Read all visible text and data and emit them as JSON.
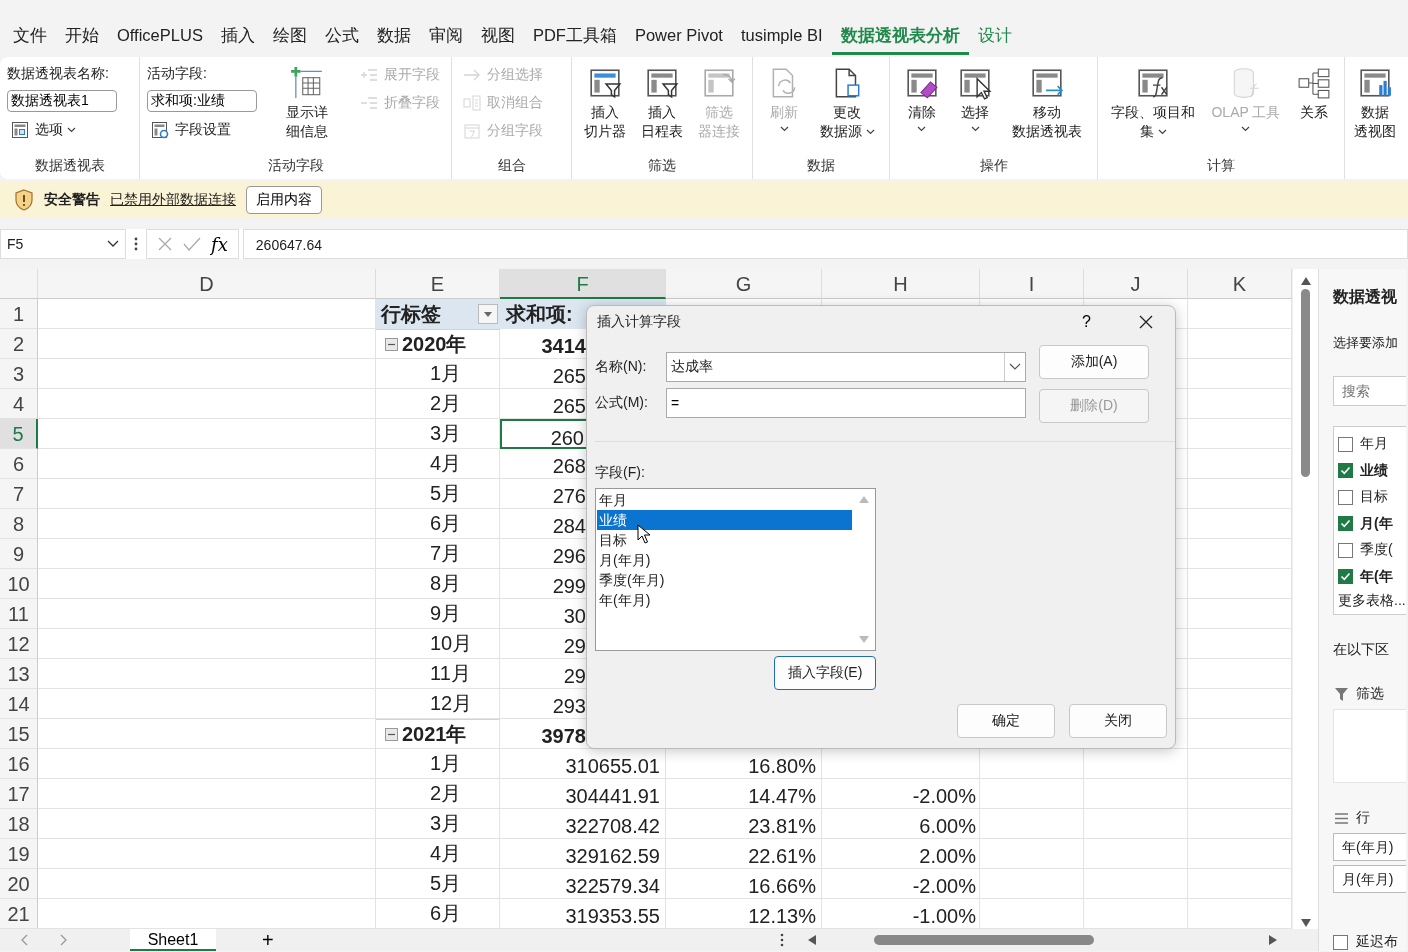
{
  "tabs": [
    {
      "label": "文件",
      "selected": false,
      "kind": "normal"
    },
    {
      "label": "开始",
      "selected": false,
      "kind": "normal"
    },
    {
      "label": "OfficePLUS",
      "selected": false,
      "kind": "normal"
    },
    {
      "label": "插入",
      "selected": false,
      "kind": "normal"
    },
    {
      "label": "绘图",
      "selected": false,
      "kind": "normal"
    },
    {
      "label": "公式",
      "selected": false,
      "kind": "normal"
    },
    {
      "label": "数据",
      "selected": false,
      "kind": "normal"
    },
    {
      "label": "审阅",
      "selected": false,
      "kind": "normal"
    },
    {
      "label": "视图",
      "selected": false,
      "kind": "normal"
    },
    {
      "label": "PDF工具箱",
      "selected": false,
      "kind": "normal"
    },
    {
      "label": "Power Pivot",
      "selected": false,
      "kind": "normal"
    },
    {
      "label": "tusimple BI",
      "selected": false,
      "kind": "normal"
    },
    {
      "label": "数据透视表分析",
      "selected": true,
      "kind": "contextual"
    },
    {
      "label": "设计",
      "selected": false,
      "kind": "contextual"
    }
  ],
  "ribbon": {
    "groups": [
      {
        "label": "数据透视表",
        "columns": [
          [
            {
              "kind": "caption",
              "text": "数据透视表名称:"
            },
            {
              "kind": "input",
              "value": "数据透视表1"
            },
            {
              "kind": "small",
              "lines": [
                "选项"
              ],
              "disabled": false,
              "dropdown": true
            }
          ]
        ]
      },
      {
        "label": "活动字段",
        "columns": [
          [
            {
              "kind": "caption",
              "text": "活动字段:"
            },
            {
              "kind": "input",
              "value": "求和项:业绩"
            },
            {
              "kind": "small",
              "lines": [
                "字段设置"
              ],
              "disabled": false,
              "dropdown": false
            }
          ],
          [
            {
              "kind": "large",
              "lines": [
                "显示详",
                "细信息"
              ],
              "disabled": false,
              "dropdown": false
            }
          ],
          [
            {
              "kind": "small",
              "lines": [
                "展开字段"
              ],
              "disabled": true,
              "dropdown": false
            },
            {
              "kind": "small",
              "lines": [
                "折叠字段"
              ],
              "disabled": true,
              "dropdown": false
            }
          ]
        ]
      },
      {
        "label": "组合",
        "columns": [
          [
            {
              "kind": "small",
              "lines": [
                "分组选择"
              ],
              "disabled": true,
              "dropdown": false
            },
            {
              "kind": "small",
              "lines": [
                "取消组合"
              ],
              "disabled": true,
              "dropdown": false
            },
            {
              "kind": "small",
              "lines": [
                "分组字段"
              ],
              "disabled": true,
              "dropdown": false
            }
          ]
        ]
      },
      {
        "label": "筛选",
        "columns": [
          [
            {
              "kind": "large",
              "lines": [
                "插入",
                "切片器"
              ],
              "disabled": false,
              "dropdown": false
            }
          ],
          [
            {
              "kind": "large",
              "lines": [
                "插入",
                "日程表"
              ],
              "disabled": false,
              "dropdown": false
            }
          ],
          [
            {
              "kind": "large",
              "lines": [
                "筛选",
                "器连接"
              ],
              "disabled": true,
              "dropdown": false
            }
          ]
        ]
      },
      {
        "label": "数据",
        "columns": [
          [
            {
              "kind": "large",
              "lines": [
                "刷新"
              ],
              "disabled": true,
              "dropdown": true
            }
          ],
          [
            {
              "kind": "large",
              "lines": [
                "更改",
                "数据源"
              ],
              "disabled": false,
              "dropdown": true
            }
          ]
        ]
      },
      {
        "label": "操作",
        "columns": [
          [
            {
              "kind": "large",
              "lines": [
                "清除"
              ],
              "disabled": false,
              "dropdown": true
            }
          ],
          [
            {
              "kind": "large",
              "lines": [
                "选择"
              ],
              "disabled": false,
              "dropdown": true
            }
          ],
          [
            {
              "kind": "large",
              "lines": [
                "移动",
                "数据透视表"
              ],
              "disabled": false,
              "dropdown": false
            }
          ]
        ]
      },
      {
        "label": "计算",
        "columns": [
          [
            {
              "kind": "large",
              "lines": [
                "字段、项目和",
                "集"
              ],
              "disabled": false,
              "dropdown": true
            }
          ],
          [
            {
              "kind": "large",
              "lines": [
                "OLAP 工具"
              ],
              "disabled": true,
              "dropdown": true
            }
          ],
          [
            {
              "kind": "large",
              "lines": [
                "关系"
              ],
              "disabled": false,
              "dropdown": false
            }
          ]
        ]
      },
      {
        "columns": [
          [
            {
              "kind": "large",
              "lines": [
                "数据",
                "透视图"
              ],
              "disabled": false,
              "dropdown": false
            }
          ]
        ]
      }
    ]
  },
  "security_bar": {
    "title": "安全警告",
    "message": "已禁用外部数据连接",
    "button": "启用内容"
  },
  "formula_bar": {
    "name_box": "F5",
    "function_button": "fx",
    "formula": "260647.64"
  },
  "sheet": {
    "columns": [
      {
        "label": "D",
        "selected": false
      },
      {
        "label": "E",
        "selected": false
      },
      {
        "label": "F",
        "selected": true
      },
      {
        "label": "G",
        "selected": false
      },
      {
        "label": "H",
        "selected": false
      },
      {
        "label": "I",
        "selected": false
      },
      {
        "label": "J",
        "selected": false
      },
      {
        "label": "K",
        "selected": false
      }
    ],
    "rows": [
      {
        "number": "1",
        "selected": false,
        "cells": [
          "",
          {
            "kind": "heading",
            "text": "行标签",
            "filter": true,
            "active": false
          },
          {
            "kind": "heading",
            "text": "求和项:",
            "filter": false,
            "active": false
          }
        ]
      },
      {
        "number": "2",
        "selected": false,
        "cells": [
          "",
          {
            "kind": "group",
            "text": "2020年",
            "expanded": true,
            "active": false
          },
          {
            "kind": "total",
            "text": "3414",
            "active": false
          }
        ]
      },
      {
        "number": "3",
        "selected": false,
        "cells": [
          "",
          {
            "kind": "label",
            "text": "1月",
            "active": false
          },
          {
            "kind": "number",
            "text": "265",
            "active": false
          }
        ]
      },
      {
        "number": "4",
        "selected": false,
        "cells": [
          "",
          {
            "kind": "label",
            "text": "2月",
            "active": false
          },
          {
            "kind": "number",
            "text": "265",
            "active": false
          }
        ]
      },
      {
        "number": "5",
        "selected": true,
        "cells": [
          "",
          {
            "kind": "label",
            "text": "3月",
            "active": false
          },
          {
            "kind": "number",
            "text": "260",
            "active": true
          }
        ]
      },
      {
        "number": "6",
        "selected": false,
        "cells": [
          "",
          {
            "kind": "label",
            "text": "4月",
            "active": false
          },
          {
            "kind": "number",
            "text": "268",
            "active": false
          }
        ]
      },
      {
        "number": "7",
        "selected": false,
        "cells": [
          "",
          {
            "kind": "label",
            "text": "5月",
            "active": false
          },
          {
            "kind": "number",
            "text": "276",
            "active": false
          }
        ]
      },
      {
        "number": "8",
        "selected": false,
        "cells": [
          "",
          {
            "kind": "label",
            "text": "6月",
            "active": false
          },
          {
            "kind": "number",
            "text": "284",
            "active": false
          }
        ]
      },
      {
        "number": "9",
        "selected": false,
        "cells": [
          "",
          {
            "kind": "label",
            "text": "7月",
            "active": false
          },
          {
            "kind": "number",
            "text": "296",
            "active": false
          }
        ]
      },
      {
        "number": "10",
        "selected": false,
        "cells": [
          "",
          {
            "kind": "label",
            "text": "8月",
            "active": false
          },
          {
            "kind": "number",
            "text": "299",
            "active": false
          }
        ]
      },
      {
        "number": "11",
        "selected": false,
        "cells": [
          "",
          {
            "kind": "label",
            "text": "9月",
            "active": false
          },
          {
            "kind": "number",
            "text": "30",
            "active": false
          }
        ]
      },
      {
        "number": "12",
        "selected": false,
        "cells": [
          "",
          {
            "kind": "label",
            "text": "10月",
            "active": false
          },
          {
            "kind": "number",
            "text": "29",
            "active": false
          }
        ]
      },
      {
        "number": "13",
        "selected": false,
        "cells": [
          "",
          {
            "kind": "label",
            "text": "11月",
            "active": false
          },
          {
            "kind": "number",
            "text": "29",
            "active": false
          }
        ]
      },
      {
        "number": "14",
        "selected": false,
        "cells": [
          "",
          {
            "kind": "label",
            "text": "12月",
            "active": false
          },
          {
            "kind": "number",
            "text": "293",
            "active": false
          }
        ]
      },
      {
        "number": "15",
        "selected": false,
        "cells": [
          "",
          {
            "kind": "group",
            "text": "2021年",
            "expanded": true,
            "active": false
          },
          {
            "kind": "total",
            "text": "3978",
            "active": false
          }
        ]
      },
      {
        "number": "16",
        "selected": false,
        "cells": [
          "",
          {
            "kind": "label",
            "text": "1月",
            "active": false
          },
          {
            "kind": "number",
            "text": "310655.01",
            "active": false
          },
          {
            "kind": "number",
            "text": "16.80%",
            "active": false
          }
        ]
      },
      {
        "number": "17",
        "selected": false,
        "cells": [
          "",
          {
            "kind": "label",
            "text": "2月",
            "active": false
          },
          {
            "kind": "number",
            "text": "304441.91",
            "active": false
          },
          {
            "kind": "number",
            "text": "14.47%",
            "active": false
          },
          {
            "kind": "number",
            "text": "-2.00%",
            "active": false
          }
        ]
      },
      {
        "number": "18",
        "selected": false,
        "cells": [
          "",
          {
            "kind": "label",
            "text": "3月",
            "active": false
          },
          {
            "kind": "number",
            "text": "322708.42",
            "active": false
          },
          {
            "kind": "number",
            "text": "23.81%",
            "active": false
          },
          {
            "kind": "number",
            "text": "6.00%",
            "active": false
          }
        ]
      },
      {
        "number": "19",
        "selected": false,
        "cells": [
          "",
          {
            "kind": "label",
            "text": "4月",
            "active": false
          },
          {
            "kind": "number",
            "text": "329162.59",
            "active": false
          },
          {
            "kind": "number",
            "text": "22.61%",
            "active": false
          },
          {
            "kind": "number",
            "text": "2.00%",
            "active": false
          }
        ]
      },
      {
        "number": "20",
        "selected": false,
        "cells": [
          "",
          {
            "kind": "label",
            "text": "5月",
            "active": false
          },
          {
            "kind": "number",
            "text": "322579.34",
            "active": false
          },
          {
            "kind": "number",
            "text": "16.66%",
            "active": false
          },
          {
            "kind": "number",
            "text": "-2.00%",
            "active": false
          }
        ]
      },
      {
        "number": "21",
        "selected": false,
        "cells": [
          "",
          {
            "kind": "label",
            "text": "6月",
            "active": false
          },
          {
            "kind": "number",
            "text": "319353.55",
            "active": false
          },
          {
            "kind": "number",
            "text": "12.13%",
            "active": false
          },
          {
            "kind": "number",
            "text": "-1.00%",
            "active": false
          }
        ]
      }
    ]
  },
  "dialog": {
    "title": "插入计算字段",
    "help": "?",
    "name_label": "名称(N):",
    "name_value": "达成率",
    "formula_label": "公式(M):",
    "formula_value": "=",
    "side_buttons": [
      {
        "label": "添加(A)",
        "disabled": false
      },
      {
        "label": "删除(D)",
        "disabled": true
      }
    ],
    "fields_label": "字段(F):",
    "fields": [
      {
        "label": "年月",
        "selected": false
      },
      {
        "label": "业绩",
        "selected": true
      },
      {
        "label": "目标",
        "selected": false
      },
      {
        "label": "月(年月)",
        "selected": false
      },
      {
        "label": "季度(年月)",
        "selected": false
      },
      {
        "label": "年(年月)",
        "selected": false
      }
    ],
    "insert_button": "插入字段(E)",
    "footer_buttons": [
      "确定",
      "关闭"
    ]
  },
  "field_pane": {
    "title": "数据透视",
    "prompt": "选择要添加",
    "search_placeholder": "搜索",
    "fields": [
      {
        "label": "年月",
        "checked": false
      },
      {
        "label": "业绩",
        "checked": true
      },
      {
        "label": "目标",
        "checked": false
      },
      {
        "label": "月(年",
        "checked": true
      },
      {
        "label": "季度(",
        "checked": false
      },
      {
        "label": "年(年",
        "checked": true
      }
    ],
    "more_tables": "更多表格...",
    "areas_caption": "在以下区",
    "filters_label": "筛选",
    "rows_label": "行",
    "row_fields": [
      "年(年月)",
      "月(年月)"
    ],
    "defer": {
      "label": "延迟布",
      "checked": false
    }
  },
  "sheet_tabs": {
    "sheets": [
      {
        "label": "Sheet1",
        "selected": true
      }
    ],
    "add_sheet": "+"
  }
}
